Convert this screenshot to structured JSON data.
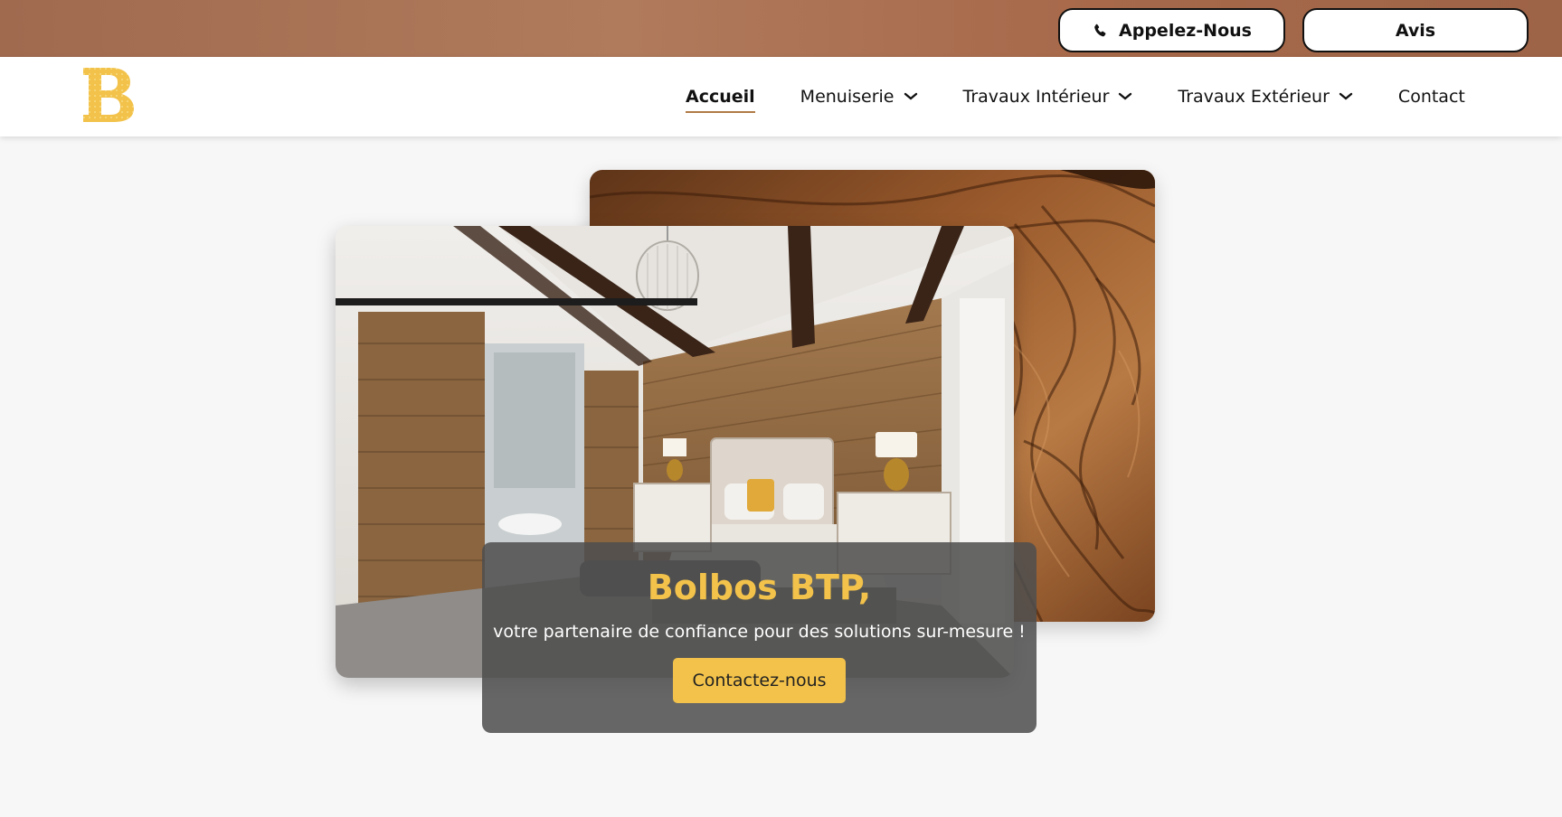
{
  "topbar": {
    "call_label": "Appelez-Nous",
    "avis_label": "Avis",
    "call_icon": "phone-icon"
  },
  "brand": {
    "logo_letter": "B",
    "logo_color": "#f2c24a"
  },
  "nav": {
    "items": [
      {
        "label": "Accueil",
        "active": true,
        "dropdown": false
      },
      {
        "label": "Menuiserie",
        "active": false,
        "dropdown": true
      },
      {
        "label": "Travaux Intérieur",
        "active": false,
        "dropdown": true
      },
      {
        "label": "Travaux Extérieur",
        "active": false,
        "dropdown": true
      },
      {
        "label": "Contact",
        "active": false,
        "dropdown": false
      }
    ]
  },
  "hero": {
    "title": "Bolbos BTP,",
    "subtitle": "votre partenaire de confiance pour des solutions sur-mesure !",
    "cta_label": "Contactez-nous",
    "back_image": "wood-grain-photo",
    "front_image": "wooden-bedroom-photo"
  },
  "colors": {
    "accent": "#f2c24a",
    "topbar": "#a7694a",
    "underline": "#b07a45"
  }
}
